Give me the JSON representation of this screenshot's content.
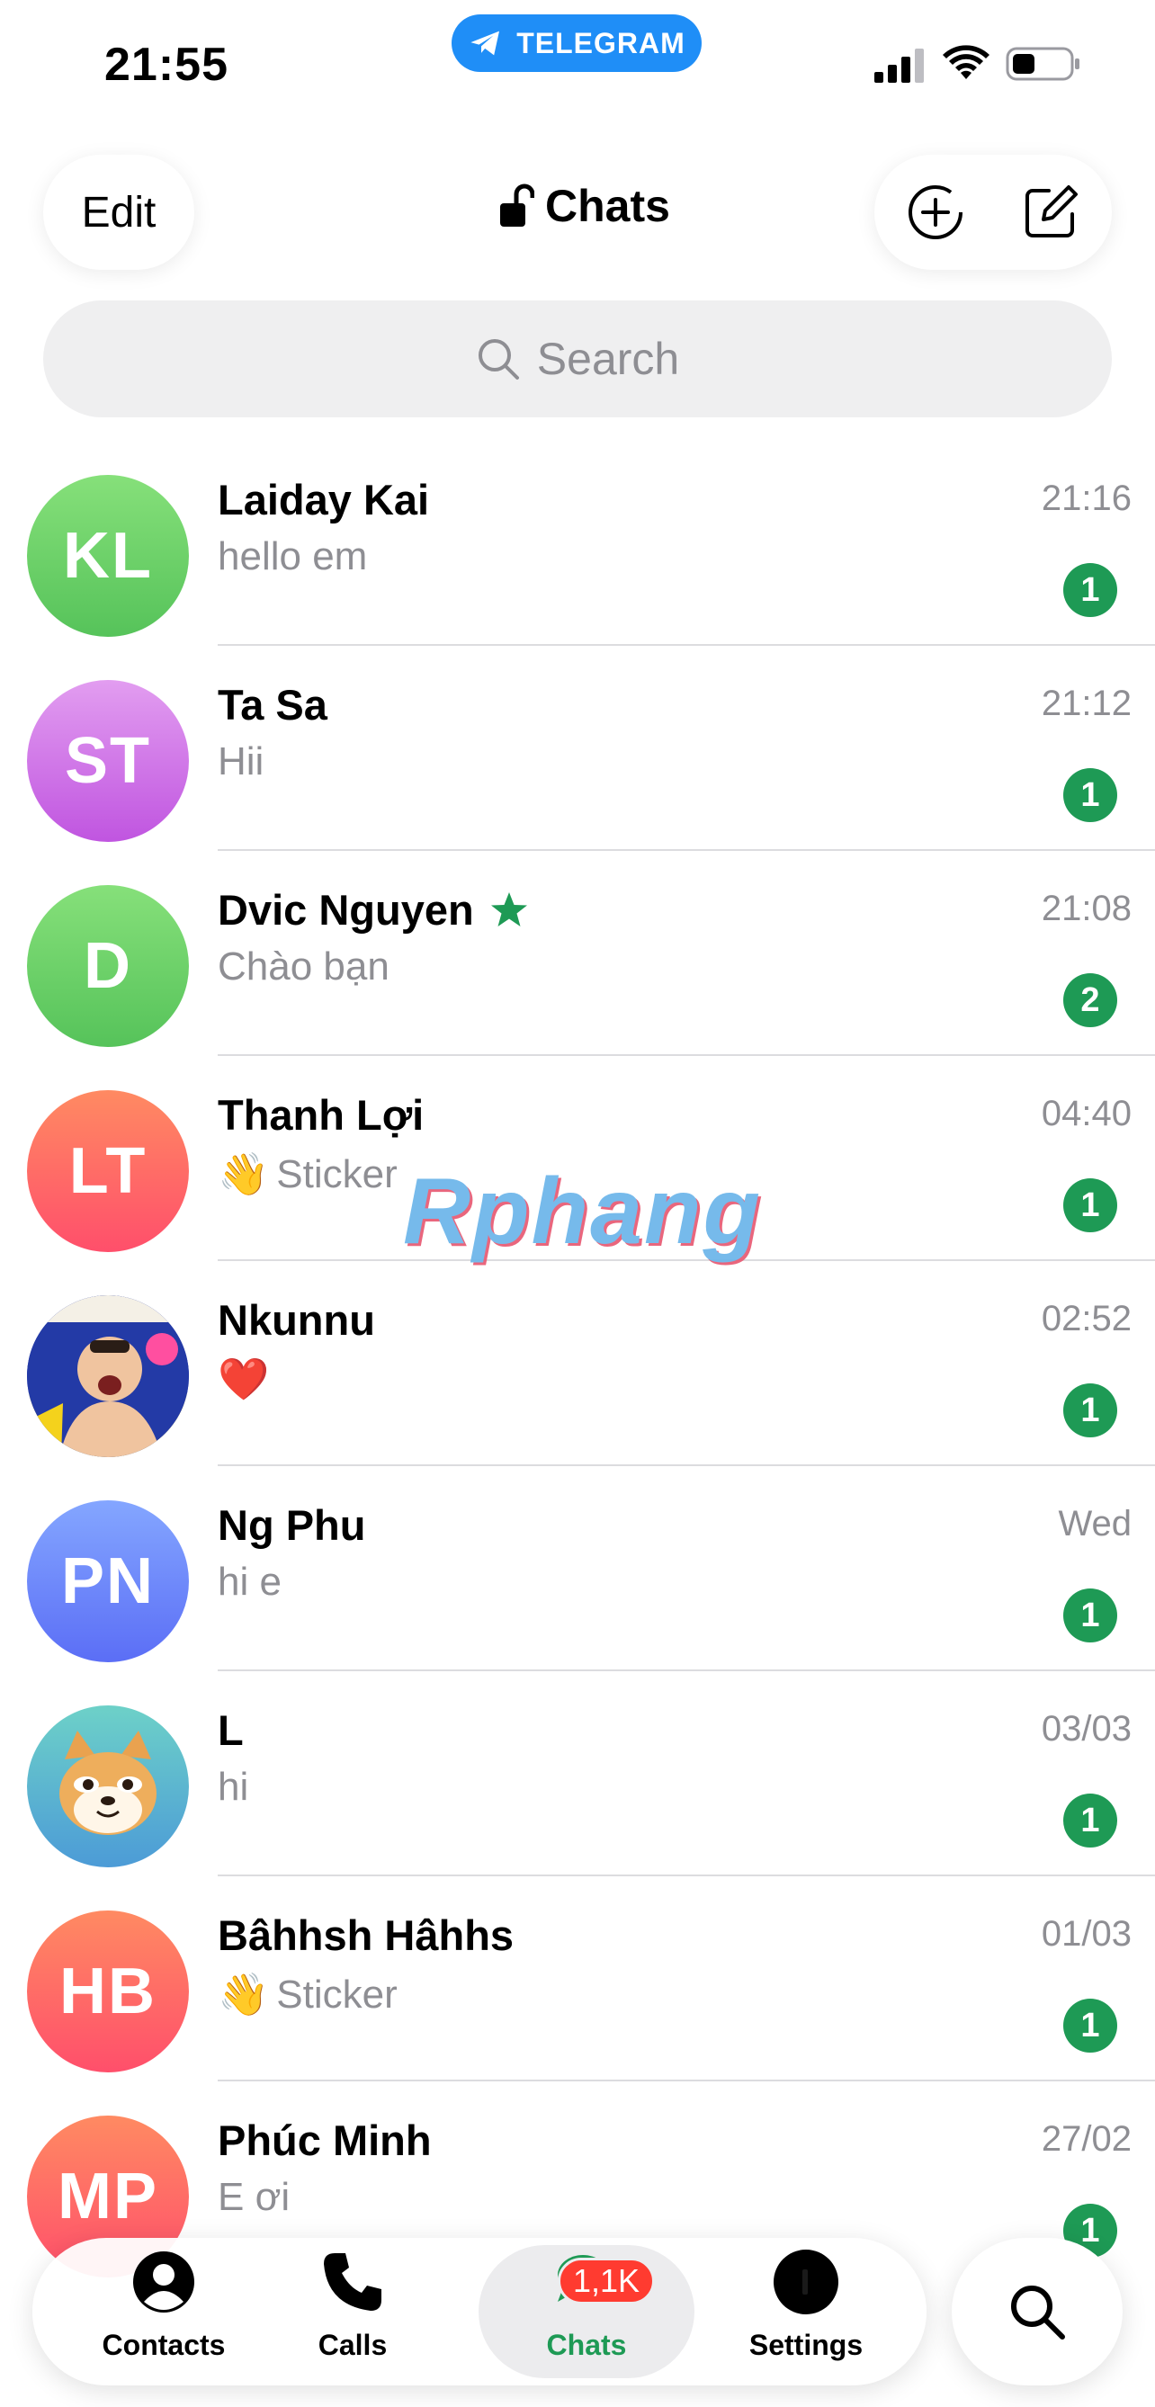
{
  "status_bar": {
    "time": "21:55",
    "app_pill": "TELEGRAM"
  },
  "header": {
    "edit_label": "Edit",
    "title": "Chats"
  },
  "search": {
    "placeholder": "Search"
  },
  "chats": [
    {
      "initials": "KL",
      "name": "Laiday Kai",
      "preview": "hello em",
      "time": "21:16",
      "unread": "1",
      "avatar_color": "#56c35a"
    },
    {
      "initials": "ST",
      "name": "Ta Sa",
      "preview": "Hii",
      "time": "21:12",
      "unread": "1",
      "avatar_color": "#c055e0"
    },
    {
      "initials": "D",
      "name": "Dvic Nguyen",
      "preview": "Chào bạn",
      "time": "21:08",
      "unread": "2",
      "avatar_color": "#56c35a",
      "badge_icon": "star-icon"
    },
    {
      "initials": "LT",
      "name": "Thanh Lợi",
      "preview_emoji": "👋",
      "preview": "Sticker",
      "time": "04:40",
      "unread": "1",
      "avatar_color": "#ff4f6b"
    },
    {
      "initials": "",
      "name": "Nkunnu",
      "preview_emoji": "❤️",
      "preview": "",
      "time": "02:52",
      "unread": "1",
      "avatar_icon": "photo-avatar"
    },
    {
      "initials": "PN",
      "name": "Ng Phu",
      "preview": "hi e",
      "time": "Wed",
      "unread": "1",
      "avatar_color": "#5b6ef6"
    },
    {
      "initials": "",
      "name": "L",
      "preview": "hi",
      "time": "03/03",
      "unread": "1",
      "avatar_icon": "shiba-dog-avatar"
    },
    {
      "initials": "HB",
      "name": "Bâhhsh Hâhhs",
      "preview_emoji": "👋",
      "preview": "Sticker",
      "time": "01/03",
      "unread": "1",
      "avatar_color": "#ff4f6b"
    },
    {
      "initials": "MP",
      "name": "Phúc Minh",
      "preview": "E ơi",
      "time": "27/02",
      "unread": "1",
      "avatar_color": "#ff4f6b"
    }
  ],
  "watermark": "Rphang",
  "tab_bar": {
    "contacts": "Contacts",
    "calls": "Calls",
    "chats": "Chats",
    "chats_badge": "1,1K",
    "settings": "Settings"
  },
  "colors": {
    "accent_green": "#1e9a55",
    "telegram_blue": "#1f8ef7",
    "badge_red": "#ff3b30"
  }
}
